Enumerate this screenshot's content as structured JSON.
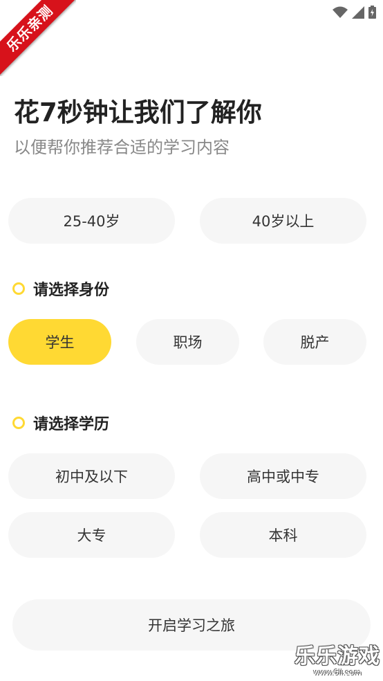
{
  "watermark": {
    "ribbon_text": "乐乐亲测",
    "site_name": "乐乐游戏",
    "site_url": "www.6ll.com"
  },
  "status_bar": {
    "icons": [
      "wifi-icon",
      "cell-signal-icon",
      "battery-charging-icon"
    ]
  },
  "header": {
    "title": "花7秒钟让我们了解你",
    "subtitle": "以便帮你推荐合适的学习内容"
  },
  "age": {
    "options": [
      {
        "label": "25-40岁",
        "selected": false
      },
      {
        "label": "40岁以上",
        "selected": false
      }
    ]
  },
  "identity": {
    "heading": "请选择身份",
    "options": [
      {
        "label": "学生",
        "selected": true
      },
      {
        "label": "职场",
        "selected": false
      },
      {
        "label": "脱产",
        "selected": false
      }
    ]
  },
  "education": {
    "heading": "请选择学历",
    "options": [
      {
        "label": "初中及以下",
        "selected": false
      },
      {
        "label": "高中或中专",
        "selected": false
      },
      {
        "label": "大专",
        "selected": false
      },
      {
        "label": "本科",
        "selected": false
      }
    ]
  },
  "start_button": {
    "label": "开启学习之旅"
  },
  "colors": {
    "accent": "#ffd933",
    "pill_bg": "#f6f6f6",
    "ribbon": "#d7121b"
  }
}
